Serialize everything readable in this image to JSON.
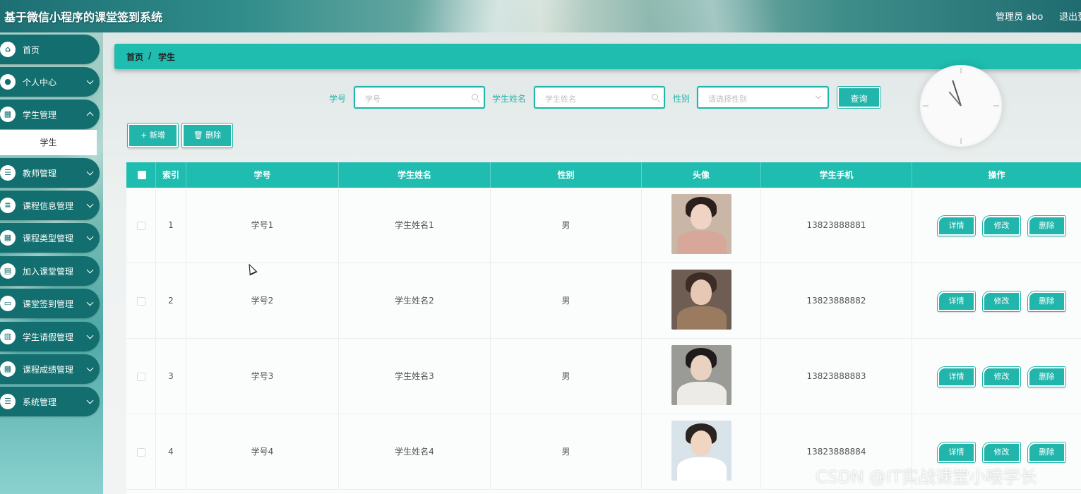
{
  "header": {
    "title": "基于微信小程序的课堂签到系统",
    "user": "管理员 abo",
    "logout": "退出登录"
  },
  "sidebar": {
    "items": [
      {
        "label": "首页",
        "icon": "home-icon",
        "glyph": "⌂"
      },
      {
        "label": "个人中心",
        "icon": "user-icon",
        "glyph": "●"
      },
      {
        "label": "学生管理",
        "icon": "grid-icon",
        "glyph": "▦"
      },
      {
        "label": "教师管理",
        "icon": "list-icon",
        "glyph": "☰"
      },
      {
        "label": "课程信息管理",
        "icon": "sliders-icon",
        "glyph": "≡"
      },
      {
        "label": "课程类型管理",
        "icon": "grid-icon",
        "glyph": "▦"
      },
      {
        "label": "加入课堂管理",
        "icon": "chart-icon",
        "glyph": "▤"
      },
      {
        "label": "课堂签到管理",
        "icon": "monitor-icon",
        "glyph": "▭"
      },
      {
        "label": "学生请假管理",
        "icon": "book-icon",
        "glyph": "▥"
      },
      {
        "label": "课程成绩管理",
        "icon": "grid-icon",
        "glyph": "▦"
      },
      {
        "label": "系统管理",
        "icon": "list-icon",
        "glyph": "☰"
      }
    ],
    "sub_item": "学生"
  },
  "breadcrumb": {
    "home": "首页",
    "sep": "/",
    "current": "学生"
  },
  "search": {
    "id_label": "学号",
    "id_placeholder": "学号",
    "name_label": "学生姓名",
    "name_placeholder": "学生姓名",
    "gender_label": "性别",
    "gender_placeholder": "请选择性别",
    "query_button": "查询"
  },
  "actions": {
    "add": "+ 新增",
    "delete": "🗑 删除"
  },
  "table": {
    "headers": [
      "索引",
      "学号",
      "学生姓名",
      "性别",
      "头像",
      "学生手机",
      "操作"
    ],
    "rows": [
      {
        "index": "1",
        "id": "学号1",
        "name": "学生姓名1",
        "gender": "男",
        "phone": "13823888881"
      },
      {
        "index": "2",
        "id": "学号2",
        "name": "学生姓名2",
        "gender": "男",
        "phone": "13823888882"
      },
      {
        "index": "3",
        "id": "学号3",
        "name": "学生姓名3",
        "gender": "男",
        "phone": "13823888883"
      },
      {
        "index": "4",
        "id": "学号4",
        "name": "学生姓名4",
        "gender": "男",
        "phone": "13823888884"
      }
    ],
    "op_labels": {
      "detail": "详情",
      "edit": "修改",
      "delete": "删除"
    }
  },
  "watermark": "CSDN @IT实战课堂小喽学长",
  "colors": {
    "accent": "#1fbcb0",
    "sidebar": "#136f6f"
  }
}
